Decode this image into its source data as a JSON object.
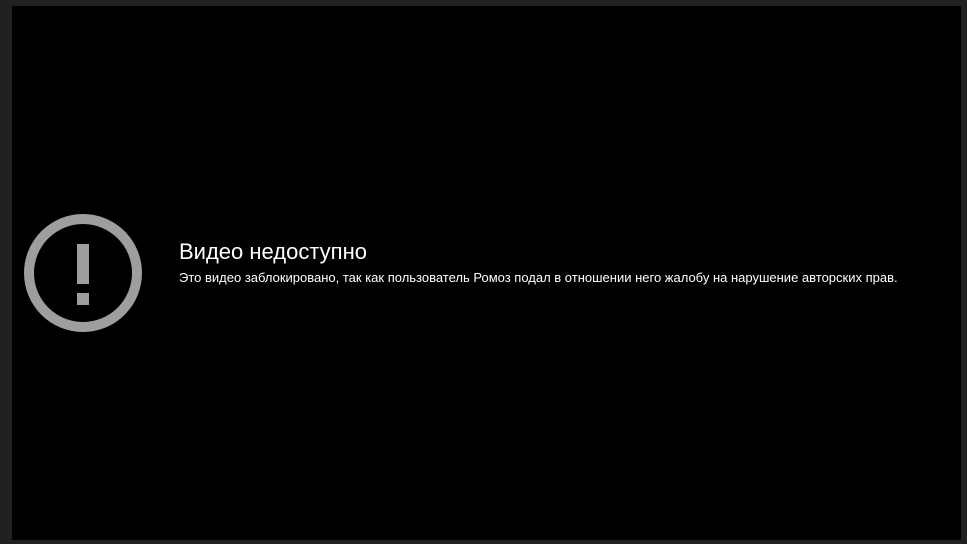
{
  "player": {
    "error": {
      "icon": "exclamation-circle-icon",
      "icon_color": "#9e9e9e",
      "title": "Видео недоступно",
      "reason": "Это видео заблокировано, так как пользователь Ромоз подал в отношении него жалобу на нарушение авторских прав."
    }
  }
}
